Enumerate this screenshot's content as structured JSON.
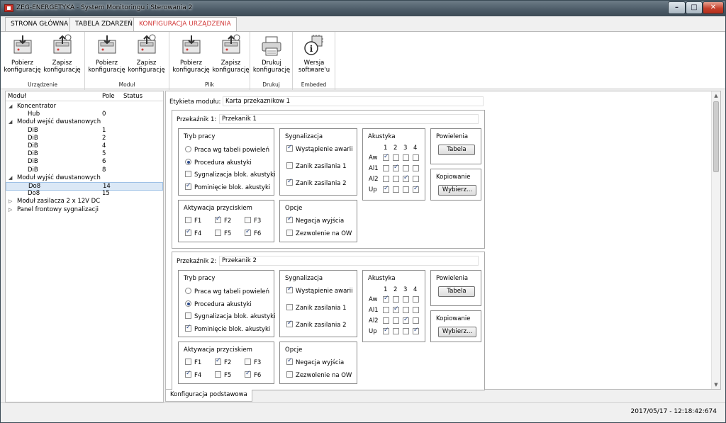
{
  "window": {
    "title": "ZEG-ENERGETYKA - System Monitoringu i Sterowania 2"
  },
  "tabs": [
    "STRONA GŁÓWNA",
    "TABELA ZDARZEŃ",
    "KONFIGURACJA URZĄDZENIA"
  ],
  "ribbon": {
    "groups": [
      {
        "label": "Urządzenie",
        "buttons": [
          [
            "Pobierz",
            "konfigurację"
          ],
          [
            "Zapisz",
            "konfigurację"
          ]
        ]
      },
      {
        "label": "Moduł",
        "buttons": [
          [
            "Pobierz",
            "konfigurację"
          ],
          [
            "Zapisz",
            "konfigurację"
          ]
        ]
      },
      {
        "label": "Plik",
        "buttons": [
          [
            "Pobierz",
            "konfigurację"
          ],
          [
            "Zapisz",
            "konfigurację"
          ]
        ]
      },
      {
        "label": "Drukuj",
        "buttons": [
          [
            "Drukuj",
            "konfigurację"
          ]
        ]
      },
      {
        "label": "Embeded",
        "buttons": [
          [
            "Wersja",
            "software'u"
          ]
        ]
      }
    ]
  },
  "tree": {
    "headers": {
      "module": "Moduł",
      "field": "Pole",
      "status": "Status"
    },
    "rows": [
      {
        "name": "Koncentrator",
        "value": "",
        "level": 0,
        "exp": "▲"
      },
      {
        "name": "Hub",
        "value": "0",
        "level": 1
      },
      {
        "name": "Moduł wejść dwustanowych",
        "value": "",
        "level": 0,
        "exp": "▲"
      },
      {
        "name": "DiB",
        "value": "1",
        "level": 1
      },
      {
        "name": "DiB",
        "value": "2",
        "level": 1
      },
      {
        "name": "DiB",
        "value": "4",
        "level": 1
      },
      {
        "name": "DiB",
        "value": "5",
        "level": 1
      },
      {
        "name": "DiB",
        "value": "6",
        "level": 1
      },
      {
        "name": "DiB",
        "value": "8",
        "level": 1
      },
      {
        "name": "Moduł wyjść dwustanowych",
        "value": "",
        "level": 0,
        "exp": "▲"
      },
      {
        "name": "Do8",
        "value": "14",
        "level": 1,
        "selected": true
      },
      {
        "name": "Do8",
        "value": "15",
        "level": 1
      },
      {
        "name": "Moduł zasilacza 2 x 12V DC",
        "value": "",
        "level": 0,
        "exp": "▷"
      },
      {
        "name": "Panel frontowy sygnalizacji",
        "value": "",
        "level": 0,
        "exp": "▷"
      }
    ]
  },
  "module": {
    "label": "Etykieta modułu:",
    "value": "Karta przekaznikow 1"
  },
  "relay_common": {
    "mode_title": "Tryb pracy",
    "signal_title": "Sygnalizacja",
    "acoustic_title": "Akustyka",
    "copies_title": "Powielenia",
    "copies_button": "Tabela",
    "copying_title": "Kopiowanie",
    "copying_button": "Wybierz...",
    "activation_title": "Aktywacja przyciskiem",
    "options_title": "Opcje",
    "grid_cols": [
      "1",
      "2",
      "3",
      "4"
    ],
    "grid_rows": [
      "Aw",
      "Al1",
      "Al2",
      "Up"
    ]
  },
  "relays": [
    {
      "label": "Przekaźnik 1:",
      "name": "Przekanik 1",
      "modes": [
        {
          "label": "Praca wg tabeli powieleń",
          "type": "radio",
          "checked": false
        },
        {
          "label": "Procedura akustyki",
          "type": "radio",
          "checked": true
        },
        {
          "label": "Sygnalizacja blok. akustyki",
          "type": "check",
          "checked": false
        },
        {
          "label": "Pominięcie blok. akustyki",
          "type": "check",
          "checked": true
        }
      ],
      "signals": [
        {
          "label": "Wystąpienie awarii",
          "checked": true
        },
        {
          "label": "Zanik zasilania 1",
          "checked": false
        },
        {
          "label": "Zanik zasilania 2",
          "checked": true
        }
      ],
      "grid": [
        [
          1,
          0,
          0,
          0
        ],
        [
          0,
          1,
          0,
          0
        ],
        [
          0,
          0,
          1,
          0
        ],
        [
          1,
          0,
          0,
          1
        ]
      ],
      "buttons": [
        {
          "label": "F1",
          "checked": false
        },
        {
          "label": "F2",
          "checked": true
        },
        {
          "label": "F3",
          "checked": false
        },
        {
          "label": "F4",
          "checked": true
        },
        {
          "label": "F5",
          "checked": false
        },
        {
          "label": "F6",
          "checked": true
        }
      ],
      "options": [
        {
          "label": "Negacja wyjścia",
          "checked": true
        },
        {
          "label": "Zezwolenie na OW",
          "checked": false
        }
      ]
    },
    {
      "label": "Przekaźnik 2:",
      "name": "Przekanik 2",
      "modes": [
        {
          "label": "Praca wg tabeli powieleń",
          "type": "radio",
          "checked": false
        },
        {
          "label": "Procedura akustyki",
          "type": "radio",
          "checked": true
        },
        {
          "label": "Sygnalizacja blok. akustyki",
          "type": "check",
          "checked": false
        },
        {
          "label": "Pominięcie blok. akustyki",
          "type": "check",
          "checked": true
        }
      ],
      "signals": [
        {
          "label": "Wystąpienie awarii",
          "checked": true
        },
        {
          "label": "Zanik zasilania 1",
          "checked": false
        },
        {
          "label": "Zanik zasilania 2",
          "checked": true
        }
      ],
      "grid": [
        [
          1,
          0,
          0,
          0
        ],
        [
          0,
          1,
          0,
          0
        ],
        [
          0,
          0,
          1,
          0
        ],
        [
          1,
          0,
          0,
          1
        ]
      ],
      "buttons": [
        {
          "label": "F1",
          "checked": false
        },
        {
          "label": "F2",
          "checked": true
        },
        {
          "label": "F3",
          "checked": false
        },
        {
          "label": "F4",
          "checked": true
        },
        {
          "label": "F5",
          "checked": false
        },
        {
          "label": "F6",
          "checked": true
        }
      ],
      "options": [
        {
          "label": "Negacja wyjścia",
          "checked": true
        },
        {
          "label": "Zezwolenie na OW",
          "checked": false
        }
      ]
    }
  ],
  "bottom_tab": "Konfiguracja podstawowa",
  "status": {
    "timestamp": "2017/05/17 - 12:18:42:674"
  },
  "colors": {
    "active_tab": "#d23b3b",
    "selection": "#dbe8f6"
  }
}
